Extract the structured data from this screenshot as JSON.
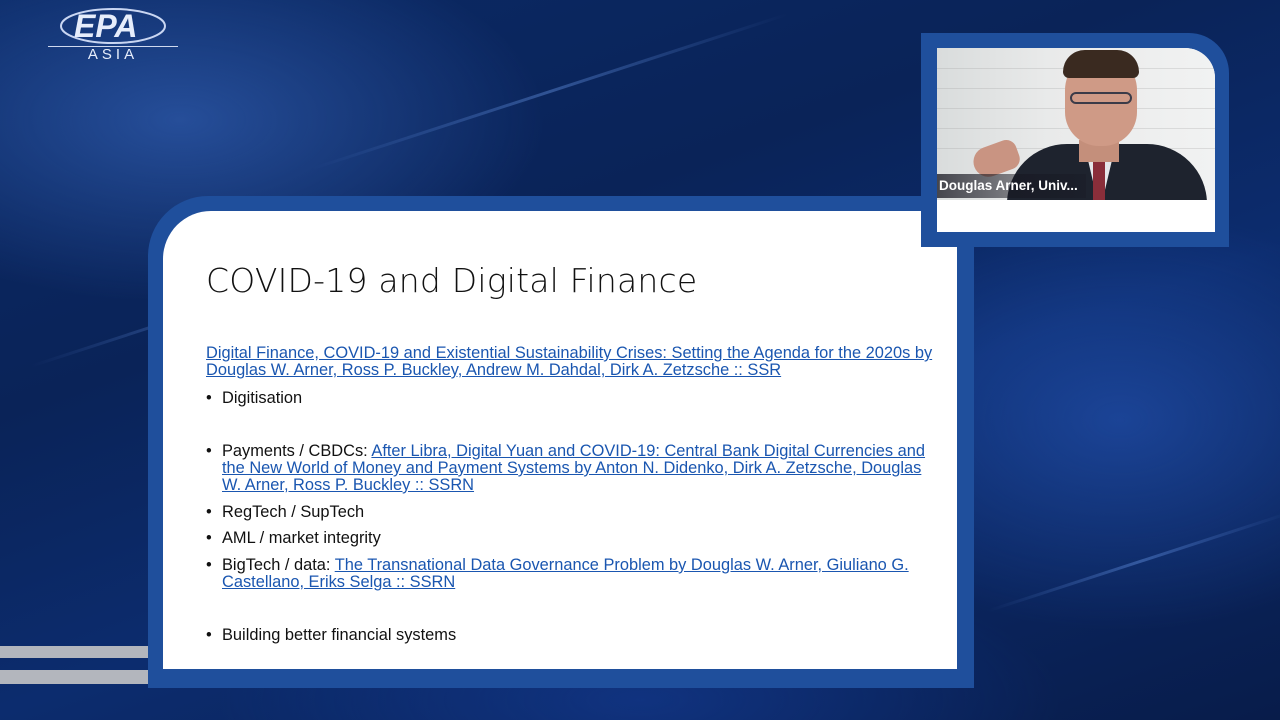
{
  "brand": {
    "logo_text": "ASIA"
  },
  "slide": {
    "title": "COVID-19 and Digital Finance",
    "ref_link": "Digital Finance, COVID-19 and Existential Sustainability Crises: Setting the Agenda for the 2020s by Douglas W. Arner, Ross P. Buckley, Andrew M. Dahdal, Dirk A. Zetzsche :: SSR",
    "bullets": [
      {
        "text": "Digitisation"
      },
      {
        "text": "Payments / CBDCs: ",
        "link": "After Libra, Digital Yuan and COVID-19: Central Bank Digital Currencies and the New World of Money and Payment Systems by Anton N. Didenko, Dirk A. Zetzsche, Douglas W. Arner, Ross P. Buckley :: SSRN"
      },
      {
        "text": "RegTech / SupTech"
      },
      {
        "text": "AML / market integrity"
      },
      {
        "text": "BigTech / data: ",
        "link": "The Transnational Data Governance Problem by Douglas W. Arner, Giuliano G. Castellano, Eriks Selga :: SSRN"
      },
      {
        "text": "Building better financial systems"
      }
    ],
    "bullet_char": "•"
  },
  "webcam": {
    "name_label": "Douglas Arner, Univ..."
  },
  "colors": {
    "frame_blue": "#1f4f9c",
    "link_blue": "#1a56b0",
    "background_navy": "#0b2a66"
  }
}
